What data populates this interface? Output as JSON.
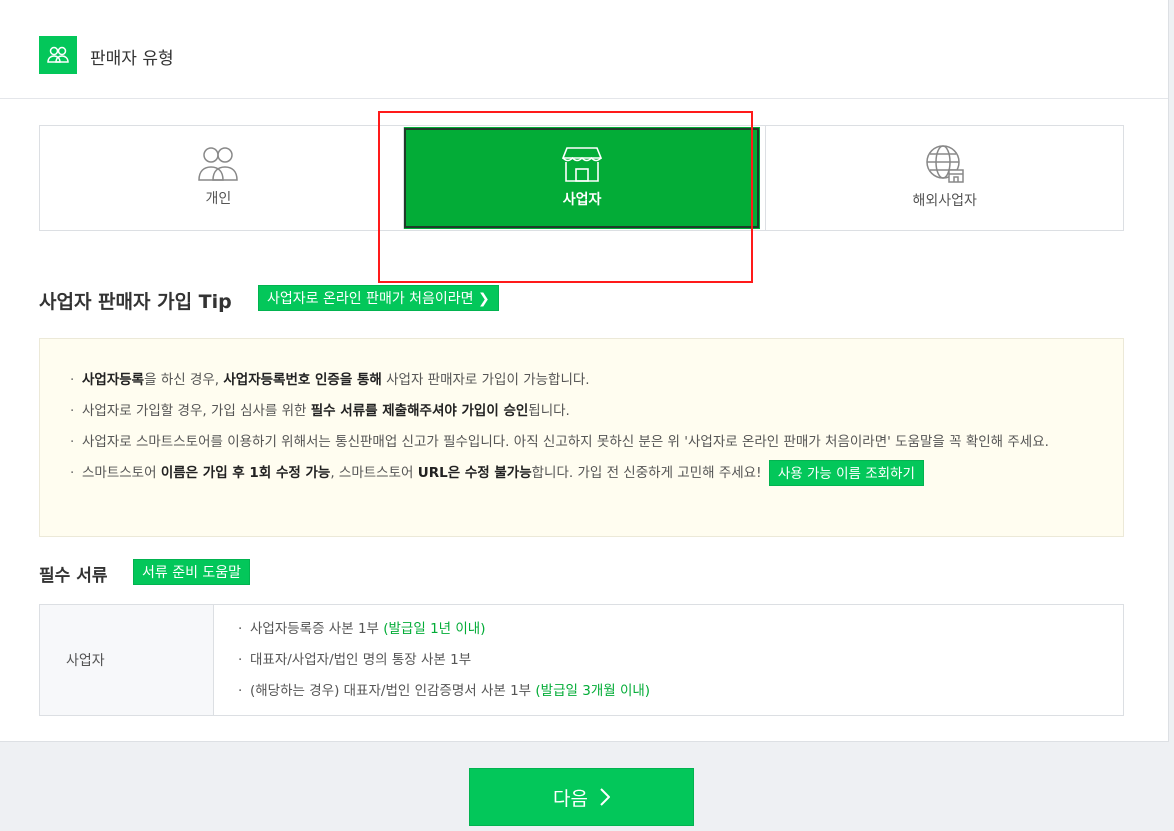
{
  "header": {
    "title": "판매자 유형",
    "icon": "users-icon"
  },
  "seller_types": [
    {
      "label": "개인",
      "icon": "person-icon",
      "selected": false
    },
    {
      "label": "사업자",
      "icon": "store-icon",
      "selected": true
    },
    {
      "label": "해외사업자",
      "icon": "globe-store-icon",
      "selected": false
    }
  ],
  "tip": {
    "title": "사업자 판매자 가입 Tip",
    "button": "사업자로 온라인 판매가 처음이라면 ❯",
    "lines": {
      "l1_b1": "사업자등록",
      "l1_t1": "을 하신 경우, ",
      "l1_b2": "사업자등록번호 인증을 통해",
      "l1_t2": " 사업자 판매자로 가입이 가능합니다.",
      "l2_t1": "사업자로 가입할 경우, 가입 심사를 위한 ",
      "l2_b1": "필수 서류를 제출해주셔야 가입이 승인",
      "l2_t2": "됩니다.",
      "l3_t1": "사업자로 스마트스토어를 이용하기 위해서는 통신판매업 신고가 필수입니다. 아직 신고하지 못하신 분은 위 '사업자로 온라인 판매가 처음이라면' 도움말을 꼭 확인해 주세요.",
      "l4_t1": "스마트스토어 ",
      "l4_b1": "이름은 가입 후 1회 수정 가능",
      "l4_t2": ", 스마트스토어 ",
      "l4_b2": "URL은 수정 불가능",
      "l4_t3": "합니다. 가입 전 신중하게 고민해 주세요!",
      "l4_btn": "사용 가능 이름 조회하기"
    }
  },
  "required": {
    "title": "필수 서류",
    "button": "서류 준비 도움말",
    "row_label": "사업자",
    "items": [
      {
        "text": "사업자등록증 사본 1부 ",
        "note": "(발급일 1년 이내)"
      },
      {
        "text": "대표자/사업자/법인 명의 통장 사본 1부",
        "note": ""
      },
      {
        "text": "(해당하는 경우) 대표자/법인 인감증명서 사본 1부 ",
        "note": "(발급일 3개월 이내)"
      }
    ]
  },
  "next_button": "다음",
  "colors": {
    "accent": "#03c75a",
    "selected": "#03ac37",
    "highlight": "#ff1a1a"
  }
}
